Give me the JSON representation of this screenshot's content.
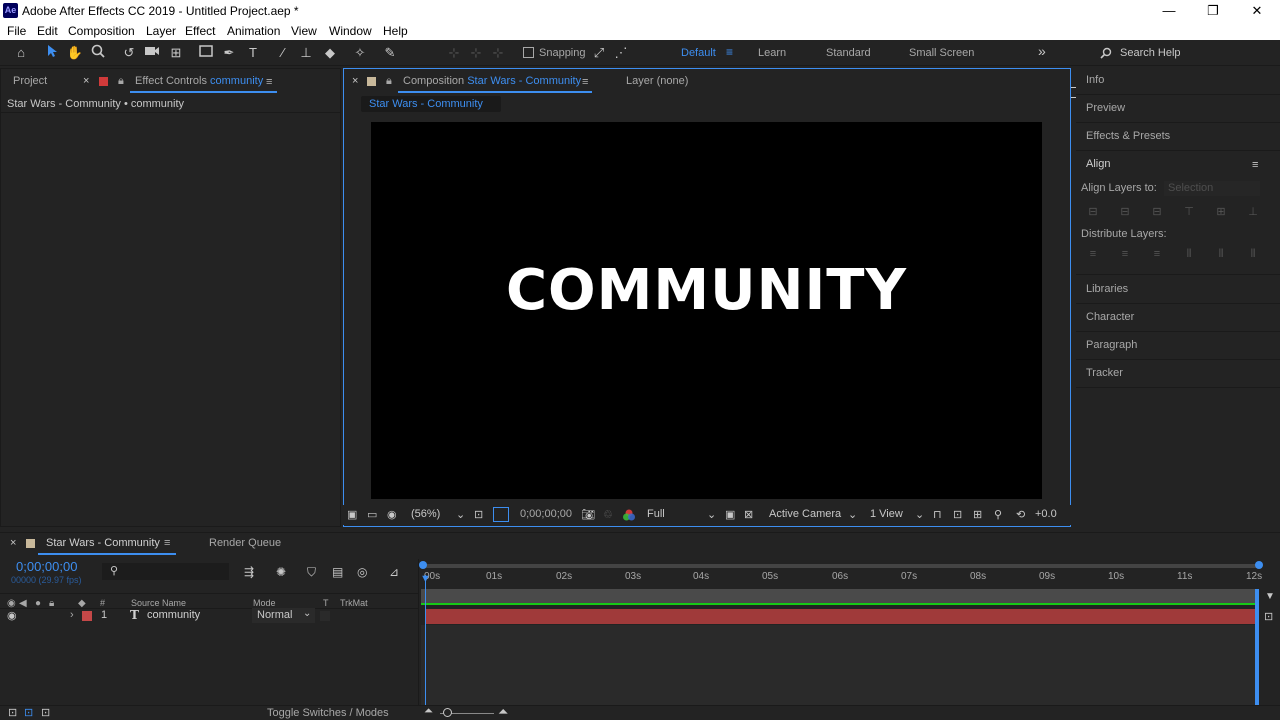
{
  "window": {
    "app_icon": "Ae",
    "title": "Adobe After Effects CC 2019 - Untitled Project.aep *",
    "minimize": "—",
    "maximize": "❐",
    "close": "✕"
  },
  "menu": [
    "File",
    "Edit",
    "Composition",
    "Layer",
    "Effect",
    "Animation",
    "View",
    "Window",
    "Help"
  ],
  "toolbar": {
    "snapping_label": "Snapping",
    "workspaces": [
      "Default",
      "Learn",
      "Standard",
      "Small Screen"
    ],
    "active_workspace": "Default",
    "more": "»",
    "search_placeholder": "Search Help"
  },
  "left_panel": {
    "tab_project": "Project",
    "tab_effect_controls_prefix": "Effect Controls",
    "tab_effect_controls_layer": "community",
    "breadcrumb": "Star Wars - Community • community"
  },
  "viewer": {
    "tab_prefix": "Composition",
    "tab_comp_name": "Star Wars - Community",
    "layer_tab": "Layer (none)",
    "sub_tab": "Star Wars - Community",
    "comp_text": "COMMUNITY",
    "zoom": "(56%)",
    "timecode": "0;00;00;00",
    "resolution": "Full",
    "camera": "Active Camera",
    "views": "1 View",
    "exposure": "+0.0"
  },
  "right_panel": {
    "items_top": [
      "Info",
      "Preview",
      "Effects & Presets"
    ],
    "align_title": "Align",
    "align_layers_to": "Align Layers to:",
    "align_target": "Selection",
    "distribute_layers": "Distribute Layers:",
    "items_bottom": [
      "Libraries",
      "Character",
      "Paragraph",
      "Tracker"
    ]
  },
  "timeline": {
    "tab_comp": "Star Wars - Community",
    "tab_render": "Render Queue",
    "current_time": "0;00;00;00",
    "frame_info": "00000 (29.97 fps)",
    "columns": {
      "num": "#",
      "source": "Source Name",
      "mode": "Mode",
      "t": "T",
      "trkmat": "TrkMat"
    },
    "ruler": [
      "00s",
      "01s",
      "02s",
      "03s",
      "04s",
      "05s",
      "06s",
      "07s",
      "08s",
      "09s",
      "10s",
      "11s",
      "12s"
    ],
    "layers": [
      {
        "index": "1",
        "type_icon": "T",
        "name": "community",
        "mode": "Normal",
        "color": "#c44848"
      }
    ],
    "toggle_label": "Toggle Switches / Modes"
  },
  "colors": {
    "accent": "#3d8ef0",
    "layer_bar": "#a03a3a",
    "work_area": "#17c917",
    "comp_swatch": "#c8b89a"
  }
}
